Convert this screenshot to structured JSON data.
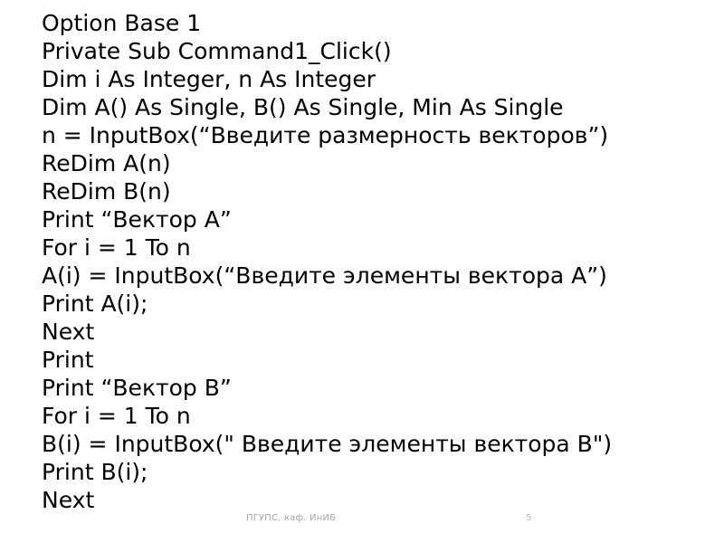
{
  "slide": {
    "background_color": "#ffffff",
    "text_color": "#000000",
    "code_lines": [
      {
        "text": "Option Base 1"
      },
      {
        "text": "Private Sub Command1_Click()"
      },
      {
        "text": "Dim i As Integer, n As Integer"
      },
      {
        "text": "Dim A() As Single, B() As Single, Min As Single"
      },
      {
        "text": "n = InputBox(“Введите размерность векторов”)"
      },
      {
        "text": "ReDim A(n)"
      },
      {
        "text": "ReDim B(n)"
      },
      {
        "text": "Print “Вектор А”"
      },
      {
        "text": "For i = 1 To n"
      },
      {
        "text": "A(i) = InputBox(“Введите элементы вектора А”)"
      },
      {
        "text": "Print A(i);"
      },
      {
        "text": "Next"
      },
      {
        "text": "Print"
      },
      {
        "text": "Print “Вектор В”"
      },
      {
        "text": "For i = 1 To n"
      },
      {
        "text": "B(i) = InputBox(\" Введите элементы вектора В\")"
      },
      {
        "text": "Print B(i);"
      },
      {
        "text": "Next"
      }
    ]
  },
  "footer": {
    "organization": "ПГУПС, каф. ИнИБ",
    "page_number": "5",
    "text_color": "#a6a6a6"
  }
}
